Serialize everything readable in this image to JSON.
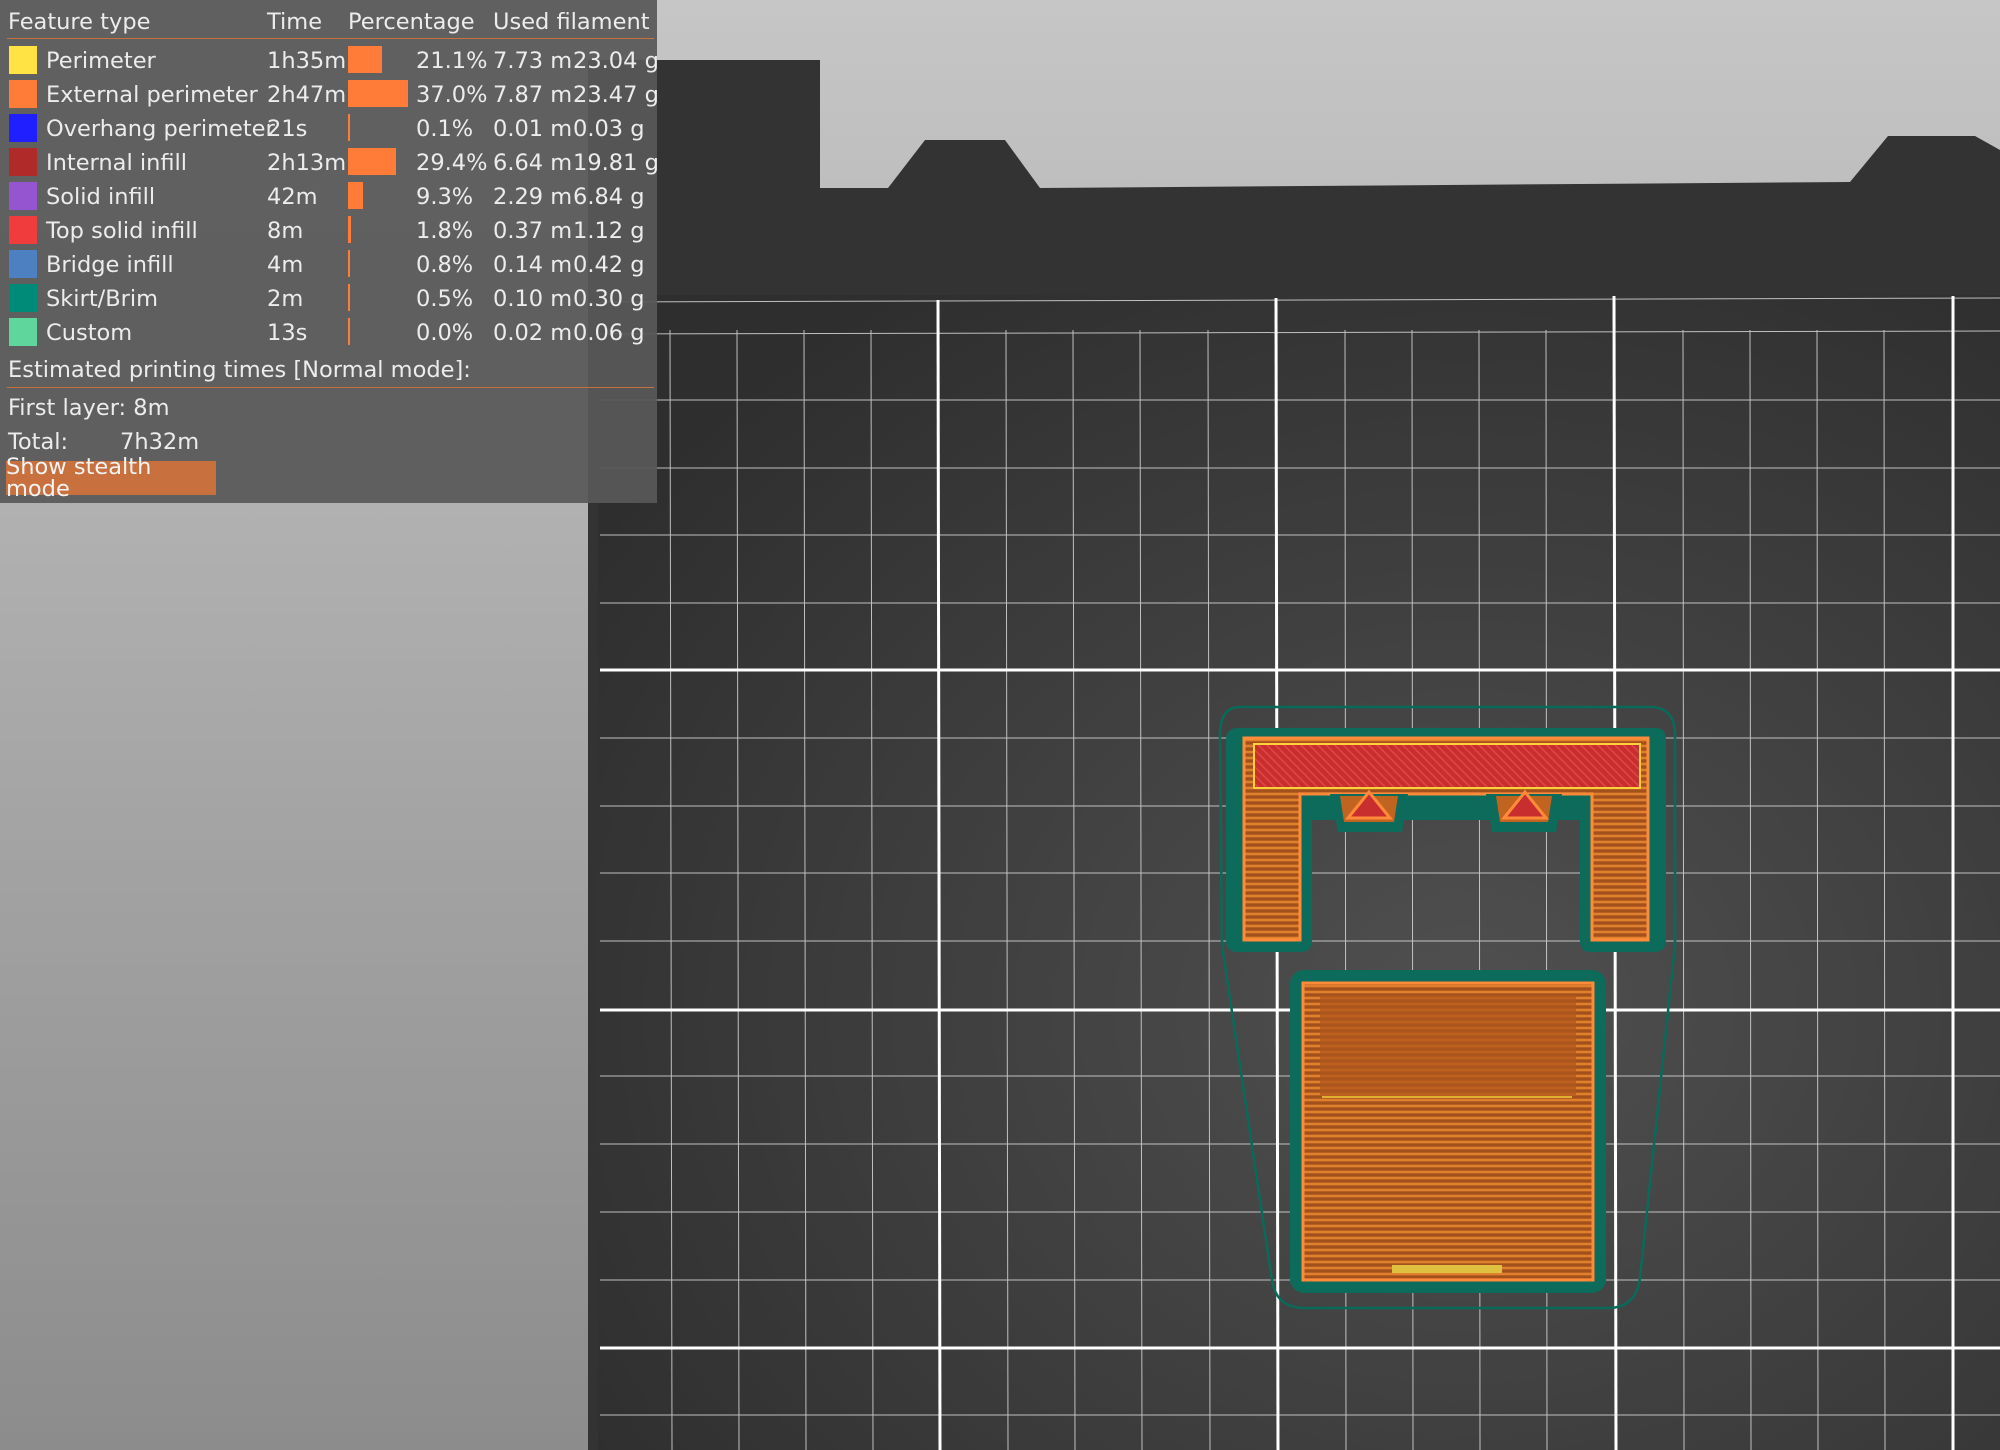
{
  "legend": {
    "headers": {
      "feature_type": "Feature type",
      "time": "Time",
      "percentage": "Percentage",
      "used_filament": "Used filament"
    },
    "rows": [
      {
        "color": "#ffe345",
        "label": "Perimeter",
        "time": "1h35m",
        "percentage": "21.1%",
        "bar_fraction": 0.211,
        "length": "7.73 m",
        "weight": "23.04 g"
      },
      {
        "color": "#ff7c38",
        "label": "External perimeter",
        "time": "2h47m",
        "percentage": "37.0%",
        "bar_fraction": 0.37,
        "length": "7.87 m",
        "weight": "23.47 g"
      },
      {
        "color": "#1f1fff",
        "label": "Overhang perimeter",
        "time": "21s",
        "percentage": "0.1%",
        "bar_fraction": 0.001,
        "length": "0.01 m",
        "weight": "0.03 g"
      },
      {
        "color": "#b02a2a",
        "label": "Internal infill",
        "time": "2h13m",
        "percentage": "29.4%",
        "bar_fraction": 0.294,
        "length": "6.64 m",
        "weight": "19.81 g"
      },
      {
        "color": "#9655d0",
        "label": "Solid infill",
        "time": "42m",
        "percentage": "9.3%",
        "bar_fraction": 0.093,
        "length": "2.29 m",
        "weight": "6.84 g"
      },
      {
        "color": "#f03c3c",
        "label": "Top solid infill",
        "time": "8m",
        "percentage": "1.8%",
        "bar_fraction": 0.018,
        "length": "0.37 m",
        "weight": "1.12 g"
      },
      {
        "color": "#4d80c0",
        "label": "Bridge infill",
        "time": "4m",
        "percentage": "0.8%",
        "bar_fraction": 0.008,
        "length": "0.14 m",
        "weight": "0.42 g"
      },
      {
        "color": "#008a78",
        "label": "Skirt/Brim",
        "time": "2m",
        "percentage": "0.5%",
        "bar_fraction": 0.005,
        "length": "0.10 m",
        "weight": "0.30 g"
      },
      {
        "color": "#5fd69c",
        "label": "Custom",
        "time": "13s",
        "percentage": "0.0%",
        "bar_fraction": 0.0,
        "length": "0.02 m",
        "weight": "0.06 g"
      }
    ],
    "estimated_title": "Estimated printing times [Normal mode]:",
    "first_layer": "First layer: 8m",
    "total_label": "Total:",
    "total_value": "7h32m",
    "stealth_button": "Show stealth mode"
  },
  "colors": {
    "bed": "#3a3a3a",
    "grid_line": "#ffffff",
    "accent": "#c8703e",
    "panel": "#585858",
    "skirt": "#006b5c",
    "model_fill": "#c06420"
  }
}
